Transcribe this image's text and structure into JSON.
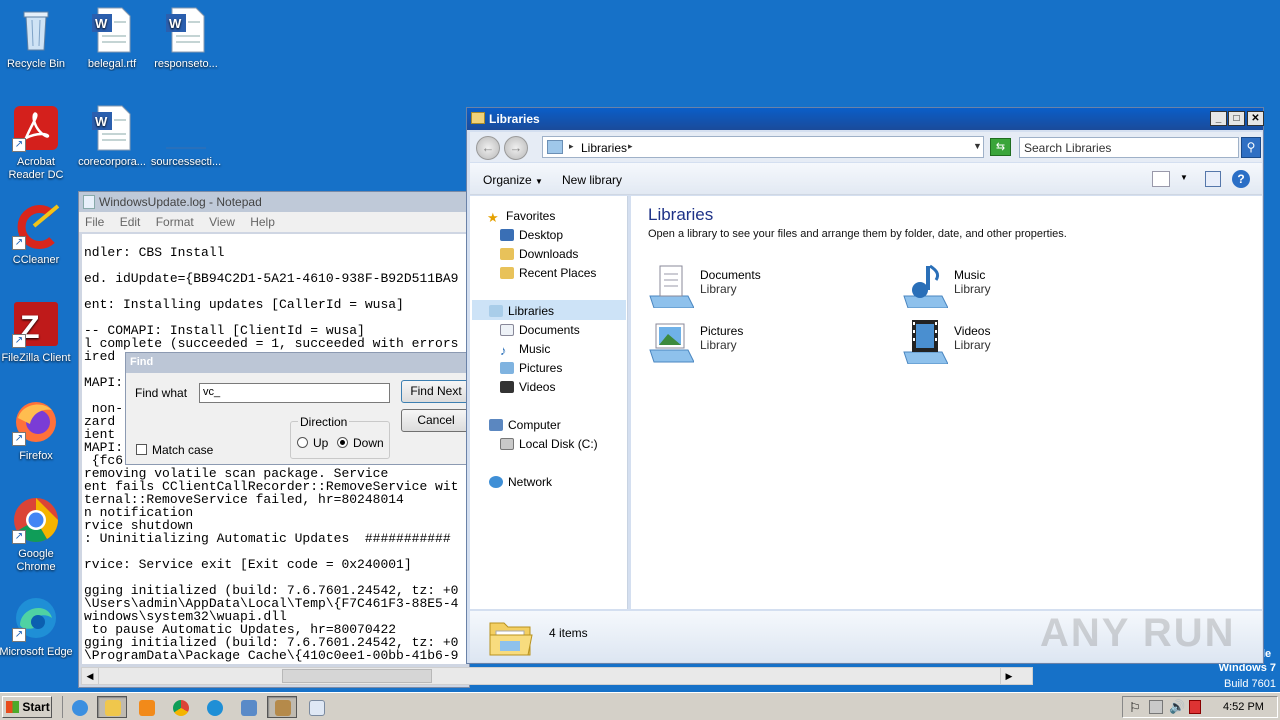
{
  "desktop": {
    "icons": [
      {
        "label": "Recycle Bin"
      },
      {
        "label": "belegal.rtf"
      },
      {
        "label": "responseto..."
      },
      {
        "label": "Acrobat Reader DC"
      },
      {
        "label": "corecorpora..."
      },
      {
        "label": "sourcessecti..."
      },
      {
        "label": "CCleaner"
      },
      {
        "label": "FileZilla Client"
      },
      {
        "label": "Firefox"
      },
      {
        "label": "Google Chrome"
      },
      {
        "label": "Microsoft Edge"
      }
    ],
    "watermark_text": "ANY RUN",
    "os_label": "Windows 7",
    "build_label": "Build 7601",
    "os_corner_fragment": "le"
  },
  "notepad": {
    "title": "WindowsUpdate.log - Notepad",
    "menu": [
      "File",
      "Edit",
      "Format",
      "View",
      "Help"
    ],
    "lines": [
      "ndler: CBS Install",
      "ed. idUpdate={BB94C2D1-5A21-4610-938F-B92D511BA9",
      "ent: Installing updates [CallerId = wusa]",
      "-- COMAPI: Install [ClientId = wusa]",
      "l complete (succeeded = 1, succeeded with errors",
      "ired",
      "MAPI:",
      " non-",
      "zard",
      "ient",
      "MAPI:",
      " {fc6",
      "removing volatile scan package. Service",
      "ent fails CClientCallRecorder::RemoveService wit",
      "ternal::RemoveService failed, hr=80248014",
      "n notification",
      "rvice shutdown",
      ": Uninitializing Automatic Updates  ###########",
      "rvice: Service exit [Exit code = 0x240001]",
      "gging initialized (build: 7.6.7601.24542, tz: +0",
      "\\Users\\admin\\AppData\\Local\\Temp\\{F7C461F3-88E5-4",
      "windows\\system32\\wuapi.dll",
      " to pause Automatic Updates, hr=80070422",
      "gging initialized (build: 7.6.7601.24542, tz: +0",
      "\\ProgramData\\Package Cache\\{410c0ee1-00bb-41b6-9"
    ]
  },
  "find_dialog": {
    "title": "Find",
    "find_what_label": "Find what",
    "find_what_value": "vc_",
    "find_next_label": "Find Next",
    "cancel_label": "Cancel",
    "direction_label": "Direction",
    "up_label": "Up",
    "down_label": "Down",
    "match_case_label": "Match case",
    "direction_selected": "Down",
    "match_case_checked": false
  },
  "explorer": {
    "title": "Libraries",
    "breadcrumb": [
      "Libraries"
    ],
    "search_placeholder": "Search Libraries",
    "toolbar": {
      "organize": "Organize",
      "new_library": "New library"
    },
    "nav": {
      "favorites": "Favorites",
      "favorite_items": [
        "Desktop",
        "Downloads",
        "Recent Places"
      ],
      "libraries": "Libraries",
      "library_items": [
        "Documents",
        "Music",
        "Pictures",
        "Videos"
      ],
      "computer": "Computer",
      "computer_items": [
        "Local Disk (C:)"
      ],
      "network": "Network"
    },
    "heading": "Libraries",
    "subheading": "Open a library to see your files and arrange them by folder, date, and other properties.",
    "libraries": [
      {
        "name": "Documents",
        "type": "Library"
      },
      {
        "name": "Music",
        "type": "Library"
      },
      {
        "name": "Pictures",
        "type": "Library"
      },
      {
        "name": "Videos",
        "type": "Library"
      }
    ],
    "status": "4 items"
  },
  "taskbar": {
    "start_label": "Start",
    "clock": "4:52 PM"
  }
}
